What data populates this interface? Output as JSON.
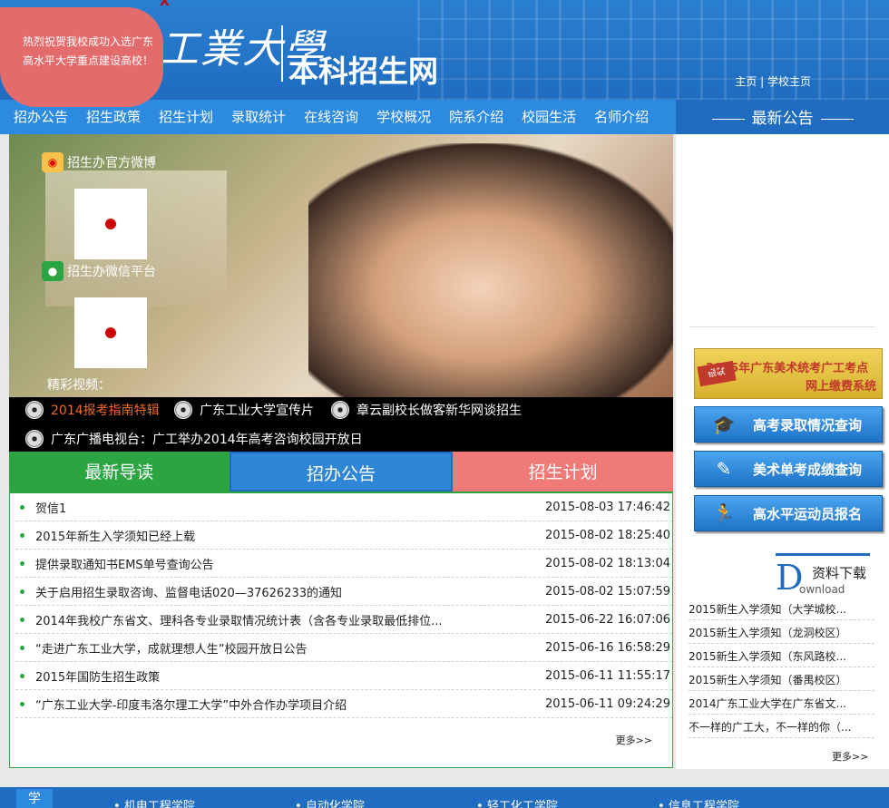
{
  "header": {
    "logo_calligraphy": "工業大學",
    "logo_subtitle": "本科招生网",
    "links": [
      "主页",
      "学校主页"
    ],
    "separator": "|"
  },
  "popup": {
    "text": "热烈祝贺我校成功入选广东高水平大学重点建设高校！",
    "close": "X"
  },
  "nav": [
    "招办公告",
    "招生政策",
    "招生计划",
    "录取统计",
    "在线咨询",
    "学校概况",
    "院系介绍",
    "校园生活",
    "名师介绍"
  ],
  "notice_title": "最新公告",
  "banner": {
    "weibo_label": "招生办官方微博",
    "wechat_label": "招生办微信平台",
    "video_label": "精彩视频："
  },
  "videos": [
    "2014报考指南特辑",
    "广东工业大学宣传片",
    "章云副校长做客新华网谈招生",
    "广东广播电视台：广工举办2014年高考咨询校园开放日"
  ],
  "tabs": [
    "最新导读",
    "招办公告",
    "招生计划"
  ],
  "news": [
    {
      "title": "贺信1",
      "date": "2015-08-03 17:46:42"
    },
    {
      "title": "2015年新生入学须知已经上载",
      "date": "2015-08-02 18:25:40"
    },
    {
      "title": "提供录取通知书EMS单号查询公告",
      "date": "2015-08-02 18:13:04"
    },
    {
      "title": "关于启用招生录取咨询、监督电话020—37626233的通知",
      "date": "2015-08-02 15:07:59"
    },
    {
      "title": "2014年我校广东省文、理科各专业录取情况统计表（含各专业录取最低排位...",
      "date": "2015-06-22 16:07:06"
    },
    {
      "title": "“走进广东工业大学，成就理想人生”校园开放日公告",
      "date": "2015-06-16 16:58:29"
    },
    {
      "title": "2015年国防生招生政策",
      "date": "2015-06-11 11:55:17"
    },
    {
      "title": "“广东工业大学-印度韦洛尔理工大学”中外合作办学项目介绍",
      "date": "2015-06-11 09:24:29"
    }
  ],
  "more": "更多>>",
  "promo": {
    "line1": "2015年广东美术统考广工考点",
    "line2": "网上缴费系统",
    "logo": "银联"
  },
  "quick_buttons": [
    "高考录取情况查询",
    "美术单考成绩查询",
    "高水平运动员报名"
  ],
  "download": {
    "letter": "D",
    "title": "资料下载",
    "subtitle": "ownload",
    "items": [
      "2015新生入学须知（大学城校...",
      "2015新生入学须知（龙洞校区）",
      "2015新生入学须知（东风路校...",
      "2015新生入学须知（番禺校区）",
      "2014广东工业大学在广东省文...",
      "不一样的广工大，不一样的你（..."
    ]
  },
  "footer": {
    "tab": "学",
    "items": [
      "机电工程学院",
      "自动化学院",
      "轻工化工学院",
      "信息工程学院"
    ]
  },
  "colors": {
    "primary_blue": "#1f6cc0",
    "green": "#2aa541",
    "red": "#ef7a78"
  }
}
